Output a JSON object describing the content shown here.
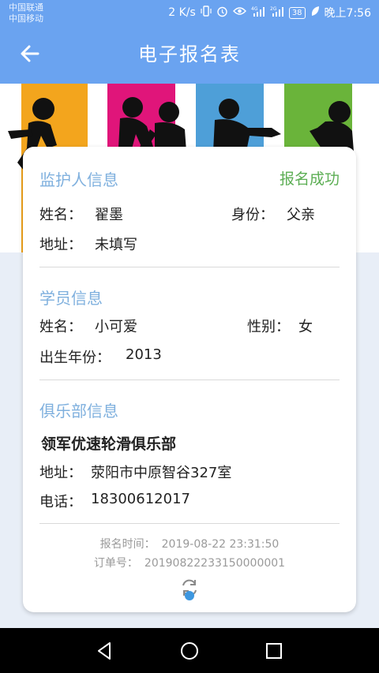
{
  "status_bar": {
    "carrier1": "中国联通",
    "carrier2": "中国移动",
    "speed": "2 K/s",
    "battery": "38",
    "time": "晚上7:56",
    "icons": [
      "vibrate-icon",
      "alarm-icon",
      "eye-icon",
      "signal-4g-icon",
      "signal-2g-icon",
      "battery-icon",
      "leaf-icon"
    ]
  },
  "appbar": {
    "title": "电子报名表",
    "back_icon": "arrow-left-icon"
  },
  "banner": {
    "colors": [
      "#f3a51d",
      "#e0157a",
      "#4e9fd8",
      "#6ab43a"
    ]
  },
  "card": {
    "status": "报名成功",
    "guardian": {
      "title": "监护人信息",
      "name_label": "姓名：",
      "name": "翟墨",
      "identity_label": "身份：",
      "identity": "父亲",
      "address_label": "地址：",
      "address": "未填写"
    },
    "student": {
      "title": "学员信息",
      "name_label": "姓名：",
      "name": "小可爱",
      "gender_label": "性别：",
      "gender": "女",
      "birth_label": "出生年份：",
      "birth": "2013"
    },
    "club": {
      "title": "俱乐部信息",
      "name": "领军优速轮滑俱乐部",
      "address_label": "地址：",
      "address": "荥阳市中原智谷327室",
      "phone_label": "电话：",
      "phone": "18300612017"
    },
    "footer": {
      "time_label": "报名时间：",
      "time": "2019-08-22 23:31:50",
      "order_label": "订单号：",
      "order": "20190822233150000001"
    }
  },
  "navbar": {
    "icons": [
      "back-triangle-icon",
      "home-circle-icon",
      "recents-square-icon"
    ]
  },
  "colors": {
    "primary": "#6aa3f0",
    "section_title": "#7fb0de",
    "success": "#5cae54",
    "refresh": "#3d97e0"
  }
}
